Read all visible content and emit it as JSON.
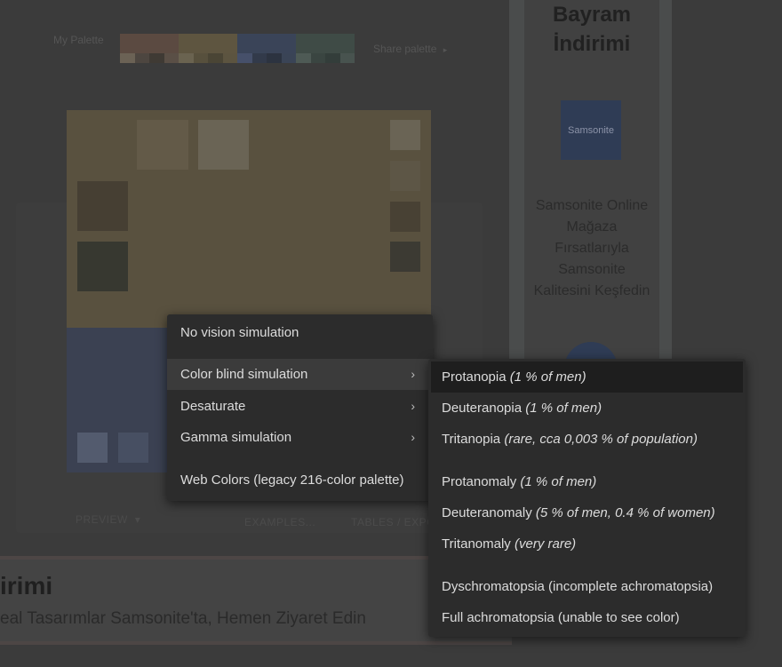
{
  "palette_bar": {
    "label": "My Palette",
    "share_label": "Share palette",
    "share_arrow": "▸",
    "groups": [
      {
        "top": "#5b4a41",
        "bottom": [
          "#6b6255",
          "#4d4640",
          "#3f3a34",
          "#5a4f46"
        ]
      },
      {
        "top": "#5e5540",
        "bottom": [
          "#6a6350",
          "#57503d",
          "#4a4535",
          "#5c5440"
        ]
      },
      {
        "top": "#3a4458",
        "bottom": [
          "#46506a",
          "#323a4a",
          "#2c3340",
          "#3a4456"
        ]
      },
      {
        "top": "#3f4b46",
        "bottom": [
          "#4e5a55",
          "#3a4541",
          "#333d3a",
          "#48534f"
        ]
      }
    ]
  },
  "preview": {
    "tabs": {
      "preview": "PREVIEW",
      "preview_arrow": "▾",
      "examples": "EXAMPLES...",
      "tables": "TABLES / EXPO"
    }
  },
  "ad": {
    "title_line1": "Bayram",
    "title_line2": "İndirimi",
    "logo_text": "Samsonite",
    "body_lines": [
      "Samsonite Online",
      "Mağaza",
      "Fırsatlarıyla",
      "Samsonite",
      "Kalitesini Keşfedin"
    ]
  },
  "banner": {
    "title": "irimi",
    "subtitle": "eal Tasarımlar Samsonite'ta, Hemen Ziyaret Edin"
  },
  "vision_menu": {
    "items": [
      {
        "label": "No vision simulation",
        "submenu": false
      },
      {
        "label": "Color blind simulation",
        "submenu": true,
        "highlighted": true
      },
      {
        "label": "Desaturate",
        "submenu": true
      },
      {
        "label": "Gamma simulation",
        "submenu": true
      },
      {
        "label": "Web Colors (legacy 216-color palette)",
        "submenu": false
      }
    ],
    "chevron": "›"
  },
  "colorblind_menu": {
    "items": [
      {
        "label": "Protanopia",
        "note": "(1 % of men)",
        "highlighted": true
      },
      {
        "label": "Deuteranopia",
        "note": "(1 % of men)"
      },
      {
        "label": "Tritanopia",
        "note": "(rare, cca 0,003 % of population)"
      },
      {
        "label": "Protanomaly",
        "note": "(1 % of men)"
      },
      {
        "label": "Deuteranomaly",
        "note": "(5 % of men, 0.4 % of women)"
      },
      {
        "label": "Tritanomaly",
        "note": "(very rare)"
      },
      {
        "label": "Dyschromatopsia (incomplete achromatopsia)",
        "note": ""
      },
      {
        "label": "Full achromatopsia (unable to see color)",
        "note": ""
      }
    ]
  }
}
